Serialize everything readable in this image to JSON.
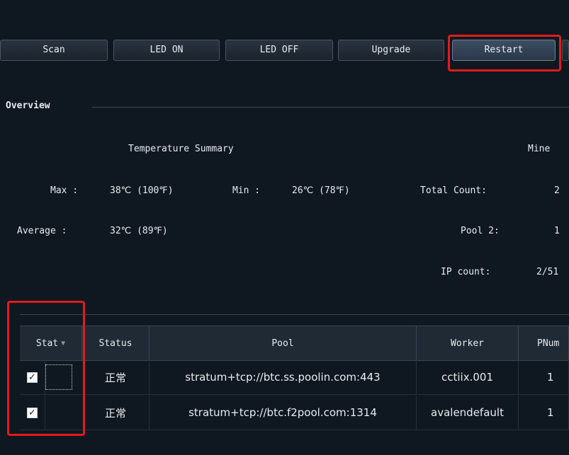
{
  "toolbar": {
    "buttons": [
      {
        "label": "Scan"
      },
      {
        "label": "LED ON"
      },
      {
        "label": "LED OFF"
      },
      {
        "label": "Upgrade"
      },
      {
        "label": "Restart"
      }
    ]
  },
  "overview": {
    "title": "Overview",
    "temperature_summary": {
      "title": "Temperature Summary",
      "max_label": "Max :",
      "max_value": "38℃ (100℉)",
      "min_label": "Min :",
      "min_value": "26℃ (78℉)",
      "average_label": "Average :",
      "average_value": "32℃ (89℉)"
    },
    "miner_summary": {
      "title_partial": "Mine",
      "total_count_label": "Total Count:",
      "total_count_value": "2",
      "pool2_label": "Pool 2:",
      "pool2_value": "1",
      "ip_count_label": "IP count:",
      "ip_count_value": "2/51"
    }
  },
  "table": {
    "headers": [
      "Stat",
      "Status",
      "Pool",
      "Worker",
      "PNum"
    ],
    "rows": [
      {
        "checked": true,
        "status": "正常",
        "pool": "stratum+tcp://btc.ss.poolin.com:443",
        "worker": "cctiix.001",
        "pnum": "1"
      },
      {
        "checked": true,
        "status": "正常",
        "pool": "stratum+tcp://btc.f2pool.com:1314",
        "worker": "avalendefault",
        "pnum": "1"
      }
    ]
  },
  "colors": {
    "background": "#0f1720",
    "highlight": "#e11c1c"
  }
}
